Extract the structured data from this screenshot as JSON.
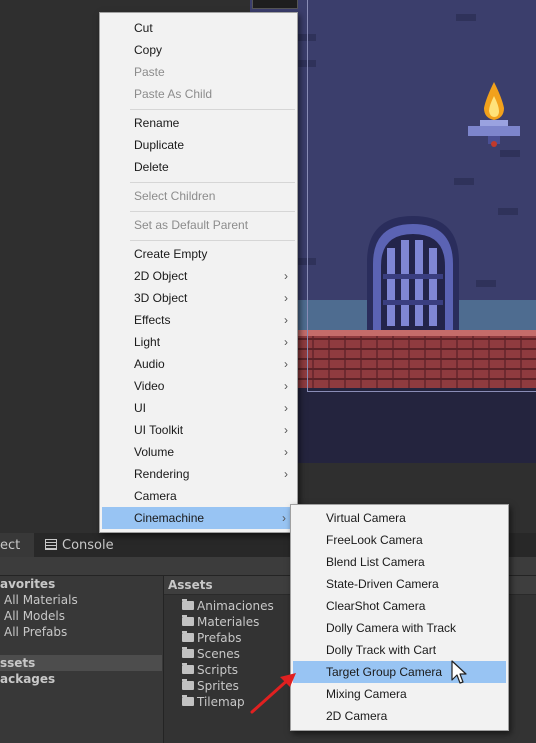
{
  "context_menu": {
    "items": [
      {
        "label": "Cut",
        "disabled": false,
        "submenu": false
      },
      {
        "label": "Copy",
        "disabled": false,
        "submenu": false
      },
      {
        "label": "Paste",
        "disabled": true,
        "submenu": false
      },
      {
        "label": "Paste As Child",
        "disabled": true,
        "submenu": false
      },
      {
        "label": "Rename",
        "disabled": false,
        "submenu": false
      },
      {
        "label": "Duplicate",
        "disabled": false,
        "submenu": false
      },
      {
        "label": "Delete",
        "disabled": false,
        "submenu": false
      },
      {
        "label": "Select Children",
        "disabled": true,
        "submenu": false
      },
      {
        "label": "Set as Default Parent",
        "disabled": true,
        "submenu": false
      },
      {
        "label": "Create Empty",
        "disabled": false,
        "submenu": false
      },
      {
        "label": "2D Object",
        "disabled": false,
        "submenu": true
      },
      {
        "label": "3D Object",
        "disabled": false,
        "submenu": true
      },
      {
        "label": "Effects",
        "disabled": false,
        "submenu": true
      },
      {
        "label": "Light",
        "disabled": false,
        "submenu": true
      },
      {
        "label": "Audio",
        "disabled": false,
        "submenu": true
      },
      {
        "label": "Video",
        "disabled": false,
        "submenu": true
      },
      {
        "label": "UI",
        "disabled": false,
        "submenu": true
      },
      {
        "label": "UI Toolkit",
        "disabled": false,
        "submenu": true
      },
      {
        "label": "Volume",
        "disabled": false,
        "submenu": true
      },
      {
        "label": "Rendering",
        "disabled": false,
        "submenu": true
      },
      {
        "label": "Camera",
        "disabled": false,
        "submenu": false
      },
      {
        "label": "Cinemachine",
        "disabled": false,
        "submenu": true,
        "highlighted": true
      }
    ]
  },
  "cinemachine_submenu": {
    "items": [
      {
        "label": "Virtual Camera"
      },
      {
        "label": "FreeLook Camera"
      },
      {
        "label": "Blend List Camera"
      },
      {
        "label": "State-Driven Camera"
      },
      {
        "label": "ClearShot Camera"
      },
      {
        "label": "Dolly Camera with Track"
      },
      {
        "label": "Dolly Track with Cart"
      },
      {
        "label": "Target Group Camera",
        "highlighted": true
      },
      {
        "label": "Mixing Camera"
      },
      {
        "label": "2D Camera"
      }
    ]
  },
  "tabs": {
    "project": "ect",
    "console": "Console"
  },
  "project_tree": {
    "favorites_header": "avorites",
    "favorites": [
      "All Materials",
      "All Models",
      "All Prefabs"
    ],
    "assets_label": "ssets",
    "packages_label": "ackages"
  },
  "assets_panel": {
    "title": "Assets",
    "folders": [
      "Animaciones",
      "Materiales",
      "Prefabs",
      "Scenes",
      "Scripts",
      "Sprites",
      "Tilemap"
    ]
  },
  "colors": {
    "menu_highlight": "#98c4f3",
    "annotation_arrow": "#e02020"
  },
  "icons": {
    "submenu": "chevron-right-icon",
    "folder": "folder-icon",
    "console": "console-icon",
    "cursor": "mouse-pointer-icon"
  }
}
